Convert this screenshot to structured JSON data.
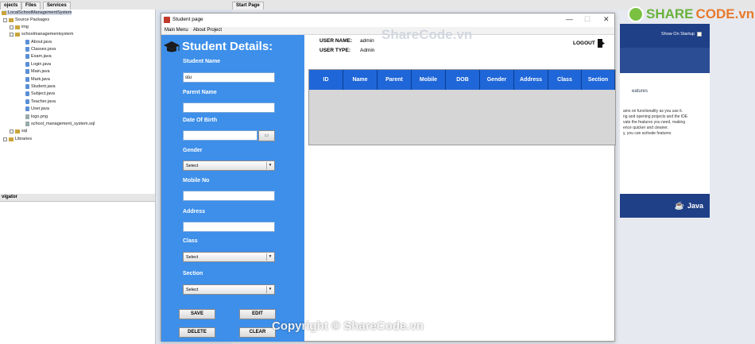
{
  "ide": {
    "tabs": [
      "ojects",
      "Files",
      "Services",
      "Start Page"
    ],
    "tree": [
      "LocalSchoolManagementSystem",
      "Source Packages",
      "img",
      "schoolmanagementsystem",
      "About.java",
      "Classes.java",
      "Exam.java",
      "Login.java",
      "Main.java",
      "Mark.java",
      "Student.java",
      "Subject.java",
      "Teacher.java",
      "User.java",
      "logo.png",
      "school_management_system.sql",
      "sql",
      "Libraries"
    ],
    "navigator_title": "vigator",
    "start_page": {
      "show_on_startup": "Show On Startup",
      "features_heading": "eatures",
      "features_text": [
        "ams on functionality as you use it.",
        "ng and opening projects and the IDE",
        "vate the features you need, making",
        "ence quicker and cleaner.",
        "y, you can activate features"
      ],
      "java_brand": "Java"
    }
  },
  "window": {
    "title": "Student page",
    "controls": [
      "—",
      "☐",
      "✕"
    ],
    "menu": [
      "Main Menu",
      "About Project"
    ]
  },
  "form": {
    "title": "Student Details:",
    "student_name_label": "Student Name",
    "student_name_value": "stu",
    "parent_name_label": "Parent Name",
    "parent_name_value": "",
    "dob_label": "Date Of Birth",
    "dob_value": "",
    "gender_label": "Gender",
    "gender_value": "Select",
    "mobile_label": "Mobile No",
    "mobile_value": "",
    "address_label": "Address",
    "address_value": "",
    "class_label": "Class",
    "class_value": "Select",
    "section_label": "Section",
    "section_value": "Select",
    "buttons": {
      "save": "SAVE",
      "edit": "EDIT",
      "delete": "DELETE",
      "clear": "CLEAR"
    }
  },
  "user": {
    "name_label": "USER NAME:",
    "name_value": "admin",
    "type_label": "USER TYPE:",
    "type_value": "Admin",
    "logout": "LOGOUT"
  },
  "table": {
    "columns": [
      "ID",
      "Name",
      "Parent",
      "Mobile",
      "DOB",
      "Gender",
      "Address",
      "Class",
      "Section"
    ]
  },
  "watermark": {
    "logo_share": "SHARE",
    "logo_code": "CODE.vn",
    "mid_text": "ShareCode.vn",
    "bottom_text": "Copyright © ShareCode.vn"
  },
  "colors": {
    "form_panel": "#3d8fea",
    "table_header": "#1f66d8",
    "table_body": "#d6d6d6"
  }
}
